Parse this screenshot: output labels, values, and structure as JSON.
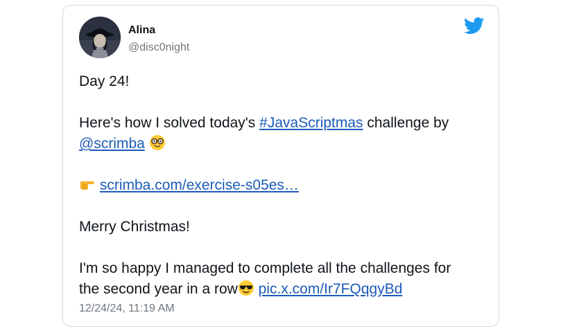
{
  "author": {
    "name": "Alina",
    "handle": "@disc0night",
    "avatar_icon": "avatar-photo"
  },
  "brand": {
    "icon": "twitter-bird-icon",
    "color": "#1d9bf0"
  },
  "tweet": {
    "line1": "Day 24!",
    "line2_pre": "Here's how I solved today's ",
    "hashtag": "#JavaScriptmas",
    "line2_post": " challenge by",
    "mention": "@scrimba",
    "link_url_text": "scrimba.com/exercise-s05es…",
    "line4": "Merry Christmas!",
    "line5": "I'm so happy I managed to complete all the challenges for",
    "line6_pre": "the second year in a row",
    "pic_link": "pic.x.com/Ir7FQqgyBd"
  },
  "emojis": {
    "nerd": "nerd-face-emoji",
    "pointing": "backhand-index-pointing-right-emoji",
    "cool": "smiling-face-with-sunglasses-emoji"
  },
  "timestamp": "12/24/24, 11:19 AM",
  "colors": {
    "link": "#1b5bb8",
    "text": "#0f1419",
    "muted": "#6e767d",
    "border": "#cfd9de"
  }
}
